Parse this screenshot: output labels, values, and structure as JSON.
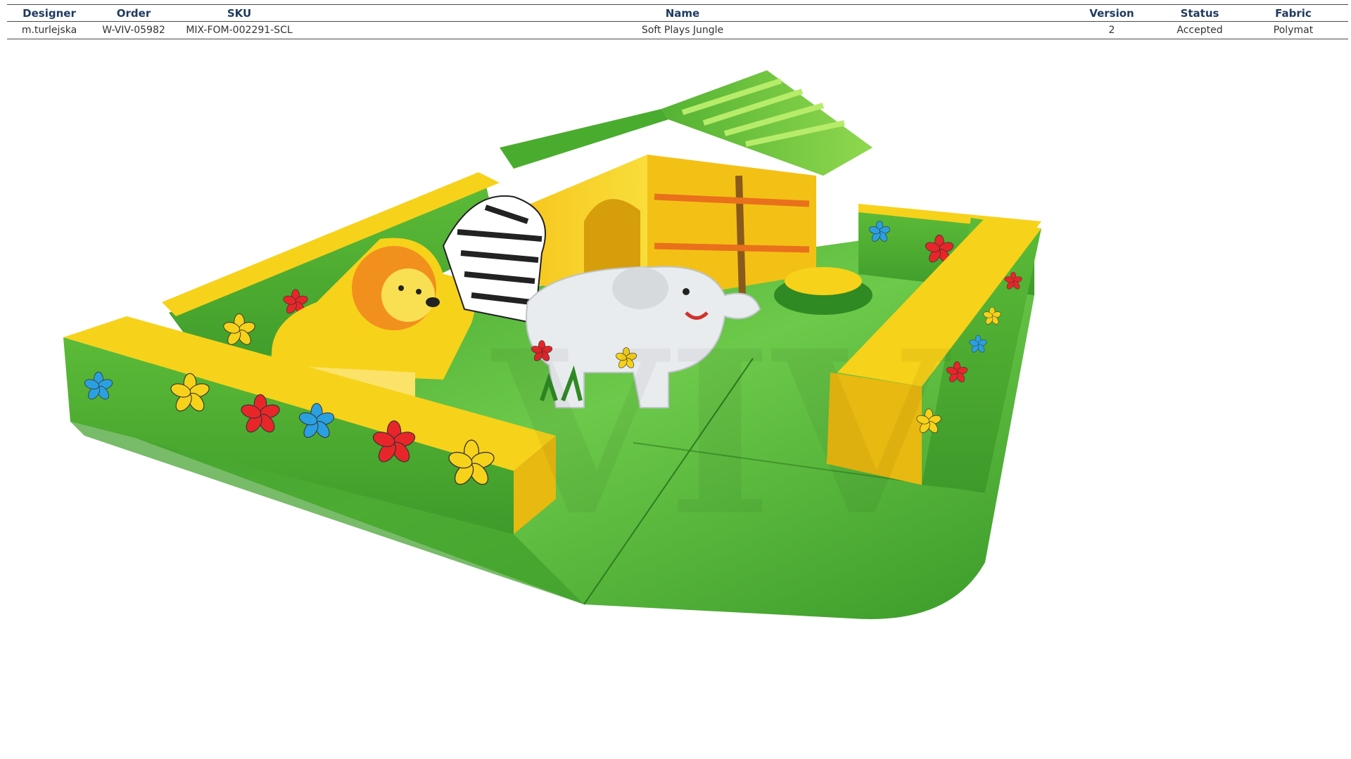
{
  "spec_table": {
    "headers": {
      "designer": "Designer",
      "order": "Order",
      "sku": "SKU",
      "name": "Name",
      "version": "Version",
      "status": "Status",
      "fabric": "Fabric"
    },
    "row": {
      "designer": "m.turlejska",
      "order": "W-VIV-05982",
      "sku": "MIX-FOM-002291-SCL",
      "name": "Soft Plays Jungle",
      "version": "2",
      "status": "Accepted",
      "fabric": "Polymat"
    }
  },
  "watermark_text": "VIV",
  "colors": {
    "header_text": "#1f3a5f",
    "foam_green": "#4aac2e",
    "foam_yellow": "#f7d21a",
    "dark_green": "#2f8a24",
    "floor_green": "#5cbf3a"
  }
}
